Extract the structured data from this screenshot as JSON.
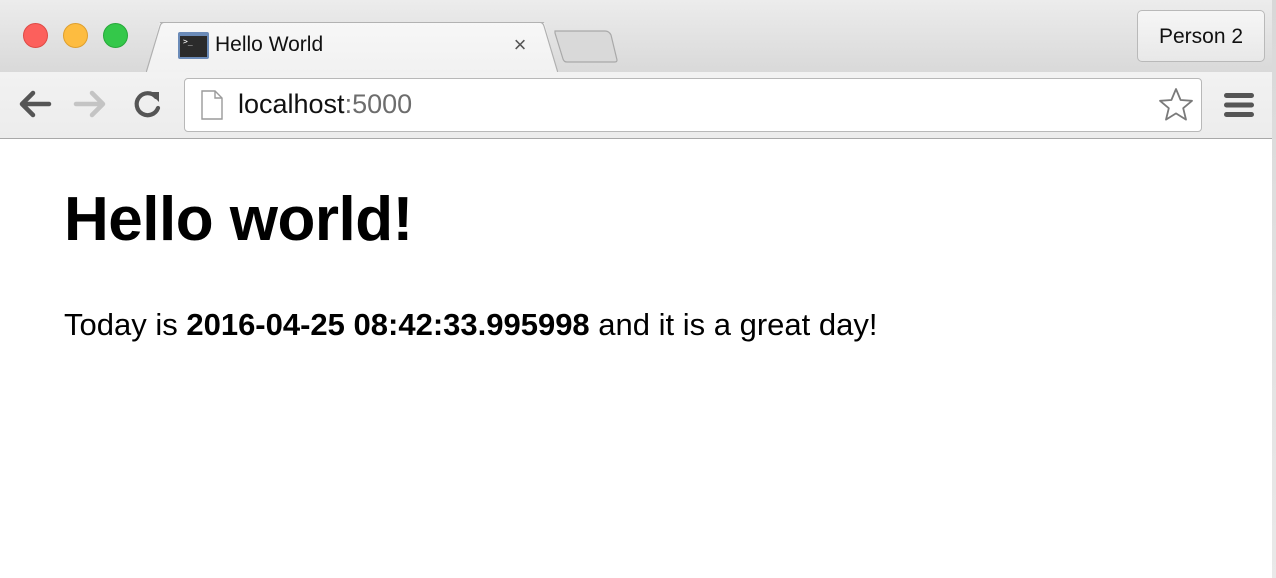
{
  "window": {
    "buttons": [
      "close",
      "minimize",
      "zoom"
    ]
  },
  "tab": {
    "title": "Hello World",
    "close_glyph": "×",
    "favicon": "terminal-icon"
  },
  "profile": {
    "label": "Person 2"
  },
  "toolbar": {
    "back_icon": "arrow-left-icon",
    "forward_icon": "arrow-right-icon",
    "reload_icon": "reload-icon",
    "menu_icon": "hamburger-menu-icon",
    "star_icon": "star-outline-icon"
  },
  "address": {
    "host": "localhost",
    "port": ":5000"
  },
  "content": {
    "heading": "Hello world!",
    "prefix": "Today is ",
    "datetime": "2016-04-25 08:42:33.995998",
    "suffix": " and it is a great day!"
  },
  "colors": {
    "close": "#fc605c",
    "minimize": "#fdbc40",
    "zoom": "#34c84a"
  }
}
